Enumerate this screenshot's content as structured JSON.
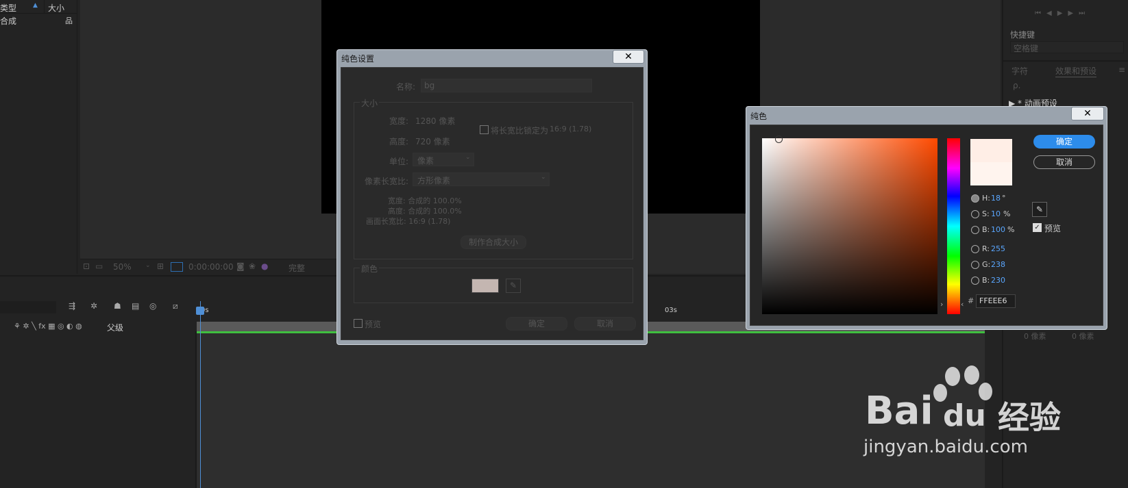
{
  "project": {
    "col_type": "类型",
    "col_size": "大小",
    "item": "合成"
  },
  "viewer": {
    "zoom": "50%",
    "timecode": "0:00:00:00",
    "quality": "完整"
  },
  "right_panel": {
    "shortcut_label": "快捷键",
    "shortcut_value": "空格键",
    "tab_char": "字符",
    "tab_effects": "效果和预设",
    "search_placeholder": "ρ.",
    "tree_item": "▶ * 动画预设",
    "px1": "0 像素",
    "px2": "0 像素",
    "side_zero": "0"
  },
  "timeline": {
    "parent_label": "父级",
    "marker_0": "0s",
    "marker_3": "03s"
  },
  "solid_dialog": {
    "title": "纯色设置",
    "name_label": "名称:",
    "name_value": "bg",
    "size_group": "大小",
    "width_label": "宽度:",
    "width_value": "1280 像素",
    "height_label": "高度:",
    "height_value": "720 像素",
    "lock_label": "将长宽比锁定为",
    "lock_value": "16:9 (1.78)",
    "unit_label": "单位:",
    "unit_value": "像素",
    "par_label": "像素长宽比:",
    "par_value": "方形像素",
    "w_pct": "宽度: 合成的 100.0%",
    "h_pct": "高度: 合成的 100.0%",
    "frame_ar": "画面长宽比: 16:9 (1.78)",
    "make_comp_size": "制作合成大小",
    "color_group": "颜色",
    "preview": "预览",
    "ok": "确定",
    "cancel": "取消",
    "swatch_color": "#c4b6b1"
  },
  "color_dialog": {
    "title": "纯色",
    "ok": "确定",
    "cancel": "取消",
    "h_label": "H:",
    "h_value": "18",
    "h_unit": "°",
    "s_label": "S:",
    "s_value": "10",
    "s_unit": "%",
    "b_label": "B:",
    "b_value": "100",
    "b_unit": "%",
    "r_label": "R:",
    "r_value": "255",
    "g_label": "G:",
    "g_value": "238",
    "bl_label": "B:",
    "bl_value": "230",
    "hash": "#",
    "hex": "FFEEE6",
    "preview": "预览",
    "preview_checked": true,
    "new_color": "#FFEEE6"
  },
  "watermark": {
    "brand_a": "Bai",
    "brand_b": "du",
    "brand_c": "经验",
    "url": "jingyan.baidu.com"
  }
}
